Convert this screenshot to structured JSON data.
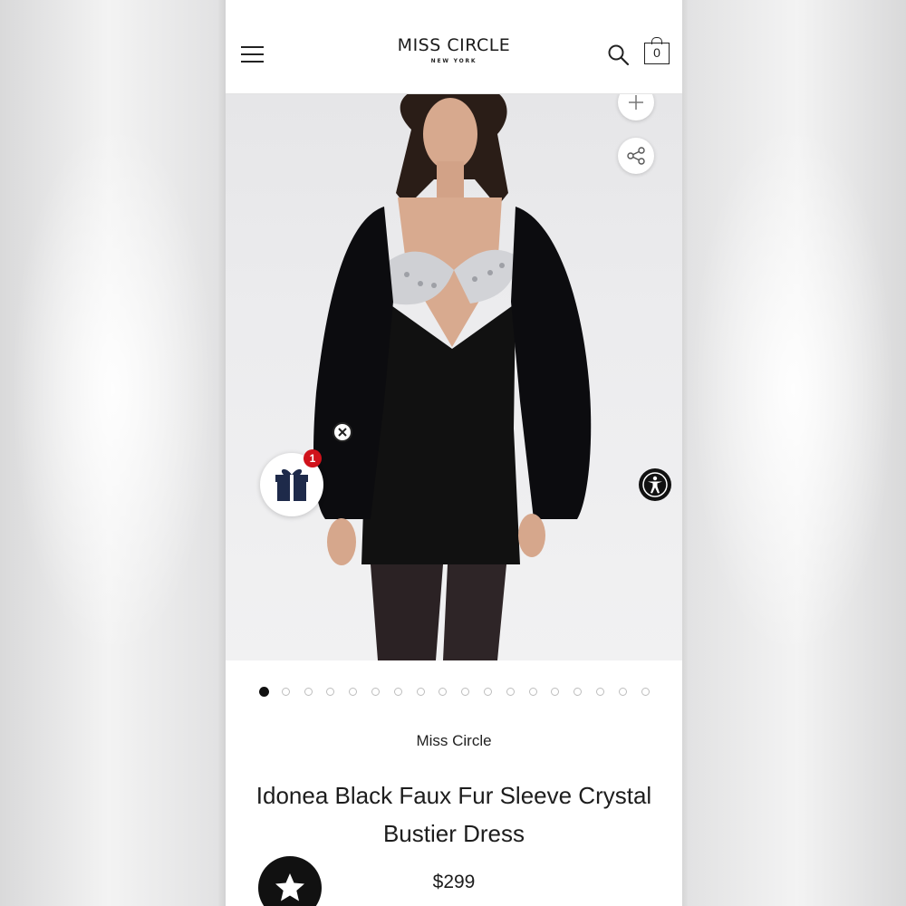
{
  "header": {
    "logo_main": "MISS CIRCLE",
    "logo_sub": "NEW YORK",
    "cart_count": "0"
  },
  "icons": {
    "menu": "hamburger-menu-icon",
    "search": "search-icon",
    "cart": "shopping-bag-icon",
    "zoom": "plus-icon",
    "share": "share-icon",
    "close": "close-icon",
    "gift": "gift-icon",
    "accessibility": "accessibility-icon",
    "reviews": "star-icon"
  },
  "promo": {
    "gift_badge": "1"
  },
  "carousel": {
    "total_slides": 18,
    "active_index": 0
  },
  "product": {
    "brand": "Miss Circle",
    "title": "Idonea Black Faux Fur Sleeve Crystal Bustier Dress",
    "price": "$299"
  },
  "colors": {
    "accent": "#111111",
    "badge": "#d0121b",
    "text": "#1d1d1d"
  }
}
